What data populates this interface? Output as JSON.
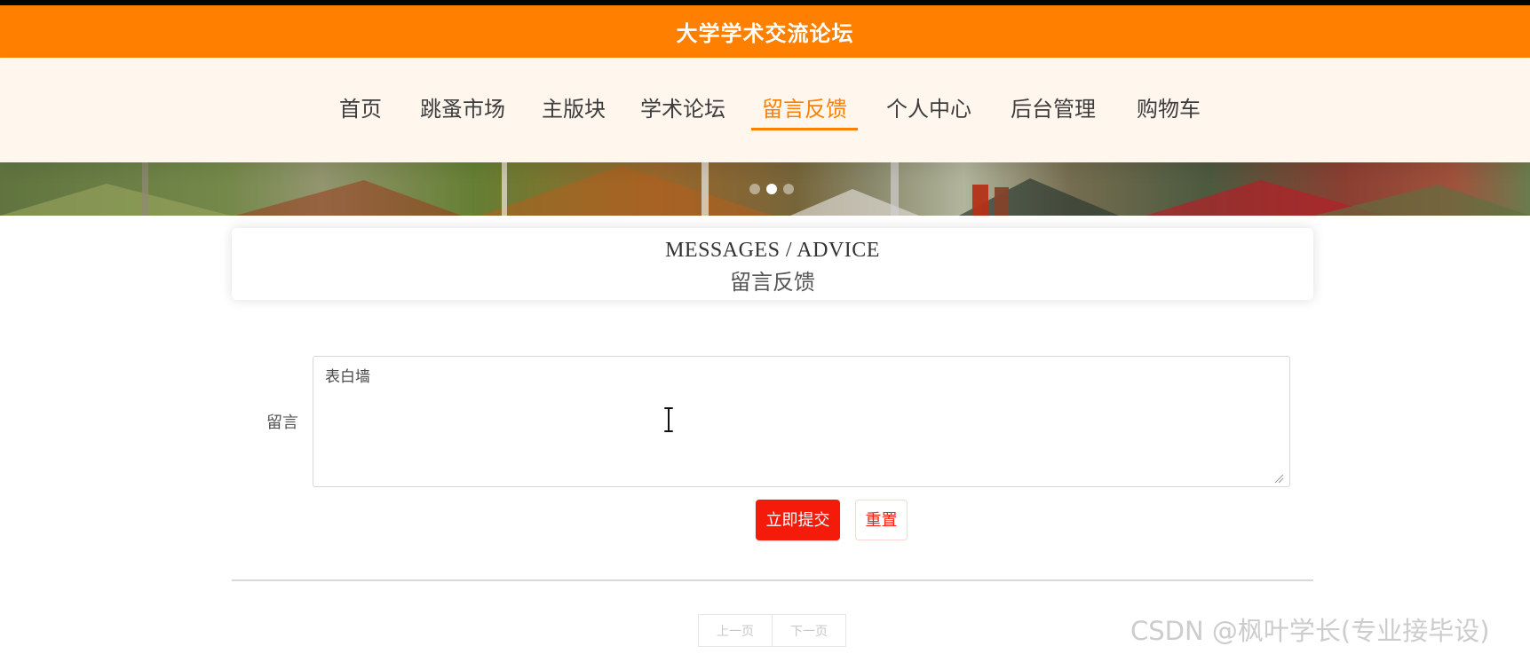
{
  "header": {
    "site_title": "大学学术交流论坛"
  },
  "nav": {
    "items": [
      {
        "label": "首页",
        "active": false
      },
      {
        "label": "跳蚤市场",
        "active": false
      },
      {
        "label": "主版块",
        "active": false
      },
      {
        "label": "学术论坛",
        "active": false
      },
      {
        "label": "留言反馈",
        "active": true
      },
      {
        "label": "个人中心",
        "active": false
      },
      {
        "label": "后台管理",
        "active": false
      },
      {
        "label": "购物车",
        "active": false
      }
    ]
  },
  "section": {
    "title_en": "MESSAGES / ADVICE",
    "title_zh": "留言反馈"
  },
  "form": {
    "label": "留言",
    "message_value": "表白墙",
    "submit_label": "立即提交",
    "reset_label": "重置"
  },
  "pagination": {
    "prev_label": "上一页",
    "next_label": "下一页"
  },
  "watermark": {
    "text": "CSDN @枫叶学长(专业接毕设)"
  },
  "colors": {
    "brand_orange": "#ff7f00",
    "submit_red": "#f51b0b",
    "nav_background": "#fff6ee"
  },
  "banner": {
    "current_slide": 2,
    "slide_count": 3
  }
}
